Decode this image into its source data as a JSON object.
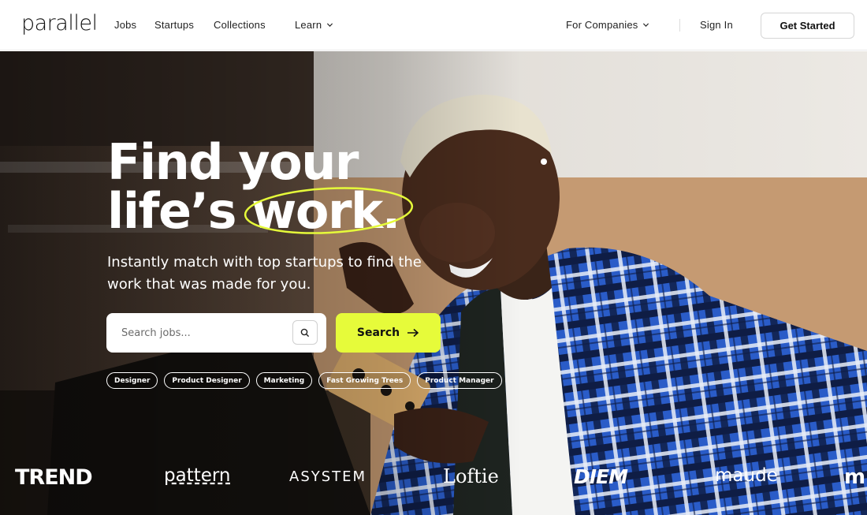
{
  "nav": {
    "logo": "parallel",
    "links": [
      "Jobs",
      "Startups",
      "Collections",
      "Learn"
    ],
    "for_companies": "For Companies",
    "sign_in": "Sign In",
    "get_started": "Get Started",
    "icons": [
      "chevron-down-icon"
    ]
  },
  "hero": {
    "headline_line1": "Find your",
    "headline_line2_a": "life’s ",
    "headline_line2_b": "work.",
    "subtitle": "Instantly match with top startups to find the work that was made for you.",
    "search_placeholder": "Search jobs...",
    "search_button": "Search",
    "chips": [
      "Designer",
      "Product Designer",
      "Marketing",
      "Fast Growing Trees",
      "Product Manager"
    ],
    "logos": [
      "TREND",
      "pattern",
      "ASYSTEM",
      "Loftie",
      "DIEM",
      "maude",
      "m"
    ]
  },
  "colors": {
    "accent": "#e6fb3a",
    "text_dark": "#111111",
    "hero_text": "#ffffff",
    "shirt_blue": "#2a5cc8"
  }
}
